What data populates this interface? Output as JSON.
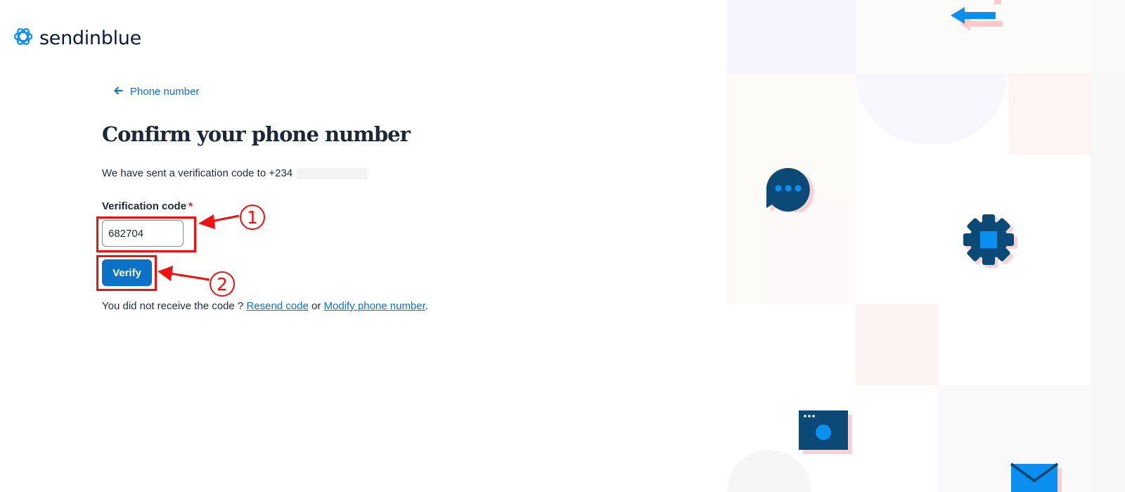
{
  "brand": {
    "name": "sendinblue",
    "logo_icon": "sendinblue-swirl-icon"
  },
  "back_link": {
    "label": "Phone number",
    "icon": "arrow-left-icon"
  },
  "heading": "Confirm your phone number",
  "sent_message": {
    "text": "We have sent a verification code to +234",
    "masked_number_icon": "redacted-block"
  },
  "verification": {
    "label": "Verification code",
    "required_mark": "*",
    "value": "682704"
  },
  "verify_button": {
    "label": "Verify"
  },
  "resend": {
    "prefix": "You did not receive the code ? ",
    "resend_link": "Resend code",
    "connector": " or ",
    "modify_link": "Modify phone number",
    "suffix": "."
  },
  "annotations": [
    {
      "number": "1",
      "target": "verification code field"
    },
    {
      "number": "2",
      "target": "verify button"
    }
  ],
  "colors": {
    "accent": "#0b72c7",
    "brand_dark": "#0b1d39",
    "annotation": "#ee1111",
    "illustration_navy": "#0b4a77",
    "illustration_blue": "#0b8ff0"
  },
  "illustration_icons": [
    "arrows-exchange-icon",
    "chat-bubble-icon",
    "gear-icon",
    "browser-window-icon",
    "envelope-icon"
  ]
}
